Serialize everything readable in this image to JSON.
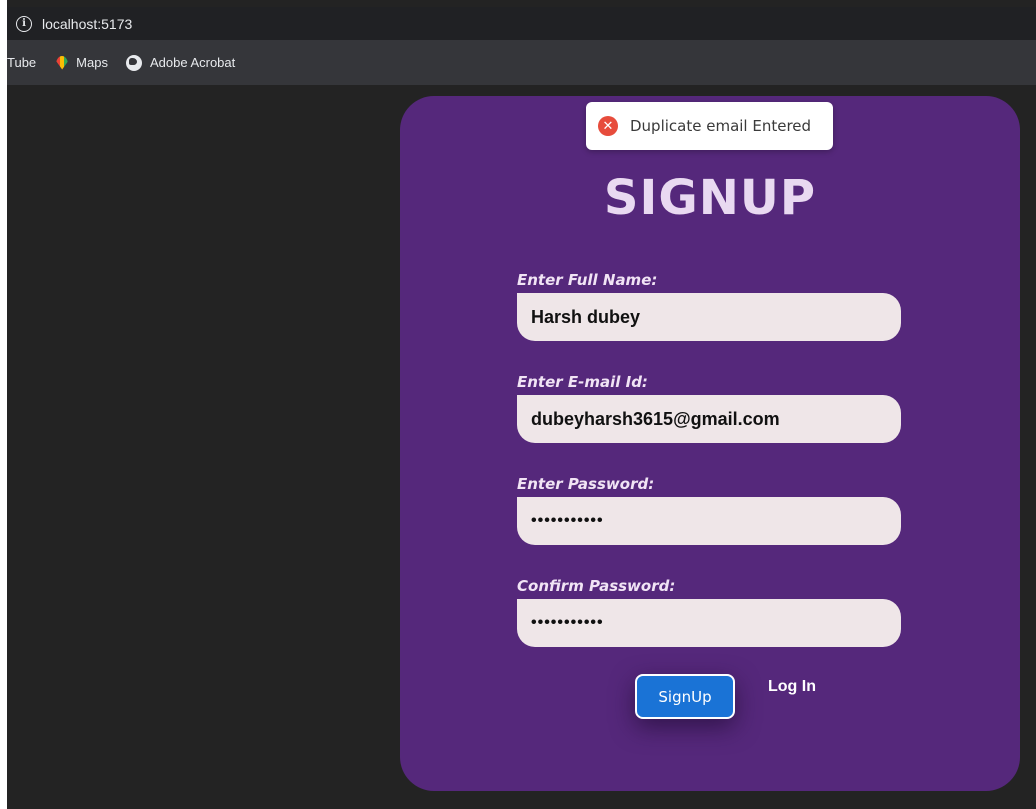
{
  "browser": {
    "url": "localhost:5173",
    "bookmarks": [
      {
        "label": "Tube",
        "icon": "youtube-icon"
      },
      {
        "label": "Maps",
        "icon": "maps-pin-icon"
      },
      {
        "label": "Adobe Acrobat",
        "icon": "globe-icon"
      }
    ]
  },
  "toast": {
    "message": "Duplicate email Entered",
    "icon": "error-x-icon",
    "color": "#e74c3c"
  },
  "form": {
    "title": "SIGNUP",
    "fields": [
      {
        "label": "Enter Full Name:",
        "value": "Harsh dubey",
        "type": "text"
      },
      {
        "label": "Enter E-mail Id:",
        "value": "dubeyharsh3615@gmail.com",
        "type": "email"
      },
      {
        "label": "Enter Password:",
        "value": "•••••••••••",
        "type": "password"
      },
      {
        "label": "Confirm Password:",
        "value": "•••••••••••",
        "type": "password"
      }
    ],
    "submit_label": "SignUp",
    "login_label": "Log In"
  },
  "colors": {
    "card": "#55287b",
    "button": "#1a73d6",
    "input_bg": "#efe6e8",
    "page_bg": "#232323"
  }
}
